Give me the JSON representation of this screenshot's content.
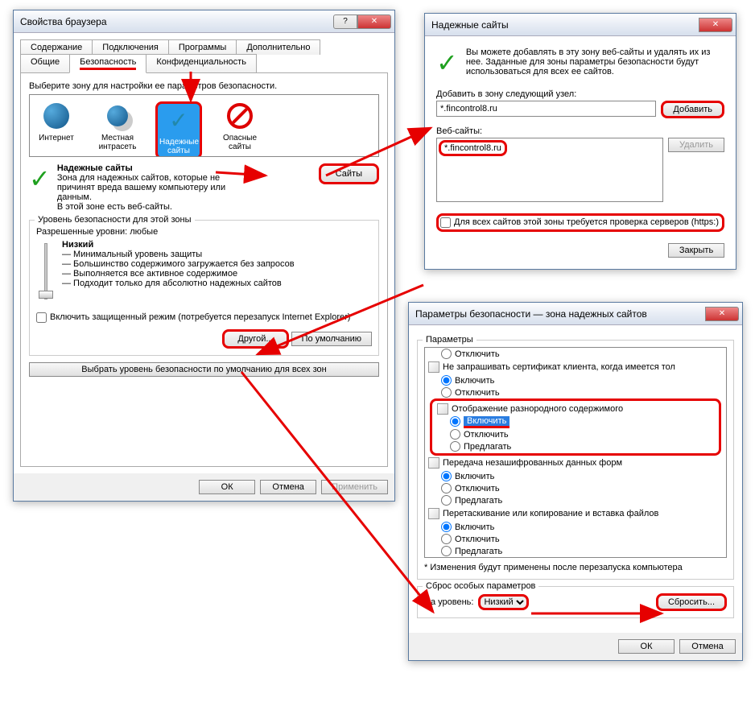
{
  "win1": {
    "title": "Свойства браузера",
    "tabs_row1": [
      "Содержание",
      "Подключения",
      "Программы",
      "Дополнительно"
    ],
    "tabs_row2": [
      "Общие",
      "Безопасность",
      "Конфиденциальность"
    ],
    "zone_prompt": "Выберите зону для настройки ее параметров безопасности.",
    "zones": {
      "internet": "Интернет",
      "intranet": "Местная интрасеть",
      "trusted": "Надежные сайты",
      "restricted": "Опасные сайты"
    },
    "trusted_heading": "Надежные сайты",
    "trusted_desc1": "Зона для надежных сайтов, которые не причинят вреда вашему компьютеру или данным.",
    "trusted_desc2": "В этой зоне есть веб-сайты.",
    "sites_btn": "Сайты",
    "sec_level_title": "Уровень безопасности для этой зоны",
    "allowed_levels": "Разрешенные уровни: любые",
    "level_name": "Низкий",
    "level_bullets": [
      "— Минимальный уровень защиты",
      "— Большинство содержимого загружается без запросов",
      "— Выполняется все активное содержимое",
      "— Подходит только для абсолютно надежных сайтов"
    ],
    "protected_mode": "Включить защищенный режим (потребуется перезапуск Internet Explorer)",
    "custom_btn": "Другой...",
    "default_btn": "По умолчанию",
    "reset_all": "Выбрать уровень безопасности по умолчанию для всех зон",
    "ok": "ОК",
    "cancel": "Отмена",
    "apply": "Применить"
  },
  "win2": {
    "title": "Надежные сайты",
    "desc": "Вы можете добавлять в эту зону  веб-сайты и удалять их из нее. Заданные для зоны параметры безопасности будут использоваться для всех ее сайтов.",
    "add_label": "Добавить в зону следующий узел:",
    "add_value": "*.fincontrol8.ru",
    "add_btn": "Добавить",
    "websites_label": "Веб-сайты:",
    "list_item": "*.fincontrol8.ru",
    "delete_btn": "Удалить",
    "https_check": "Для всех сайтов этой зоны требуется проверка серверов (https:)",
    "close_btn": "Закрыть"
  },
  "win3": {
    "title": "Параметры безопасности — зона надежных сайтов",
    "params_title": "Параметры",
    "items": {
      "off1": "Отключить",
      "nocert": "Не запрашивать сертификат клиента, когда имеется тол",
      "on1": "Включить",
      "off2": "Отключить",
      "mixed": "Отображение разнородного содержимого",
      "on2": "Включить",
      "off3": "Отключить",
      "prompt1": "Предлагать",
      "unenc": "Передача незашифрованных данных форм",
      "on3": "Включить",
      "off4": "Отключить",
      "prompt2": "Предлагать",
      "dragdrop": "Перетаскивание или копирование и вставка файлов",
      "on4": "Включить",
      "off5": "Отключить",
      "prompt3": "Предлагать"
    },
    "restart_note": "* Изменения будут применены после перезапуска компьютера",
    "reset_title": "Сброс особых параметров",
    "level_label": "На уровень:",
    "level_value": "Низкий",
    "reset_btn": "Сбросить...",
    "ok": "ОК",
    "cancel": "Отмена"
  }
}
